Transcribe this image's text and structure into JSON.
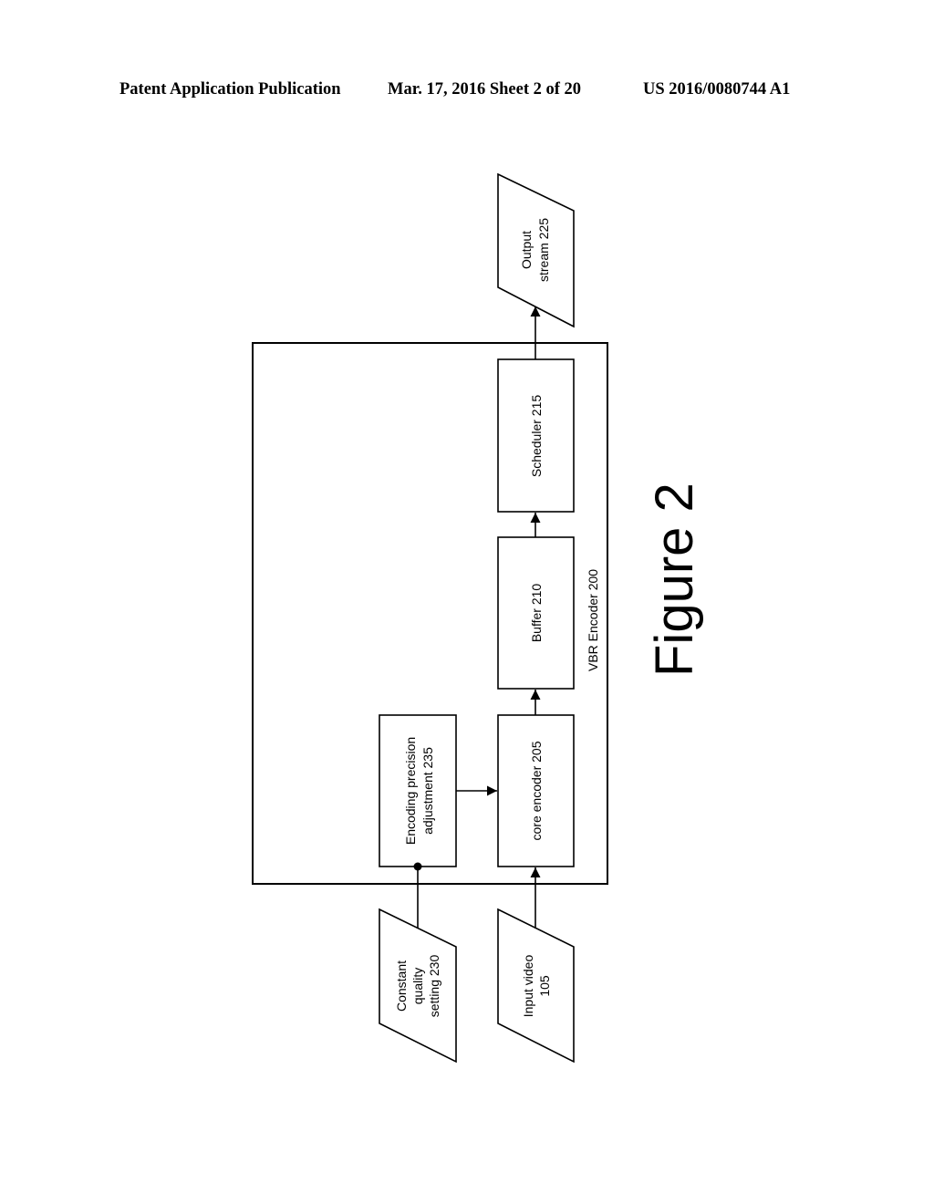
{
  "header": {
    "publication": "Patent Application Publication",
    "date_sheet": "Mar. 17, 2016  Sheet 2 of 20",
    "patent_number": "US 2016/0080744 A1"
  },
  "diagram": {
    "container": {
      "label": "VBR Encoder 200"
    },
    "blocks": {
      "core_encoder": {
        "label": "core encoder 205"
      },
      "buffer": {
        "label": "Buffer 210"
      },
      "scheduler": {
        "label": "Scheduler 215"
      },
      "encoding_precision": {
        "line1": "Encoding precision",
        "line2": "adjustment 235"
      }
    },
    "io": {
      "input_video": {
        "line1": "Input video",
        "line2": "105"
      },
      "constant_quality": {
        "line1": "Constant",
        "line2": "quality",
        "line3": "setting 230"
      },
      "output_stream": {
        "line1": "Output",
        "line2": "stream 225"
      }
    },
    "connections": [
      {
        "from": "Input video 105",
        "to": "core encoder 205",
        "type": "arrow"
      },
      {
        "from": "core encoder 205",
        "to": "Buffer 210",
        "type": "arrow"
      },
      {
        "from": "Buffer 210",
        "to": "Scheduler 215",
        "type": "arrow"
      },
      {
        "from": "Scheduler 215",
        "to": "Output stream 225",
        "type": "arrow"
      },
      {
        "from": "Encoding precision adjustment 235",
        "to": "core encoder 205",
        "type": "arrow"
      },
      {
        "from": "Constant quality setting 230",
        "to": "Encoding precision adjustment 235",
        "type": "dot-connector"
      }
    ]
  },
  "figure_label": "Figure 2"
}
